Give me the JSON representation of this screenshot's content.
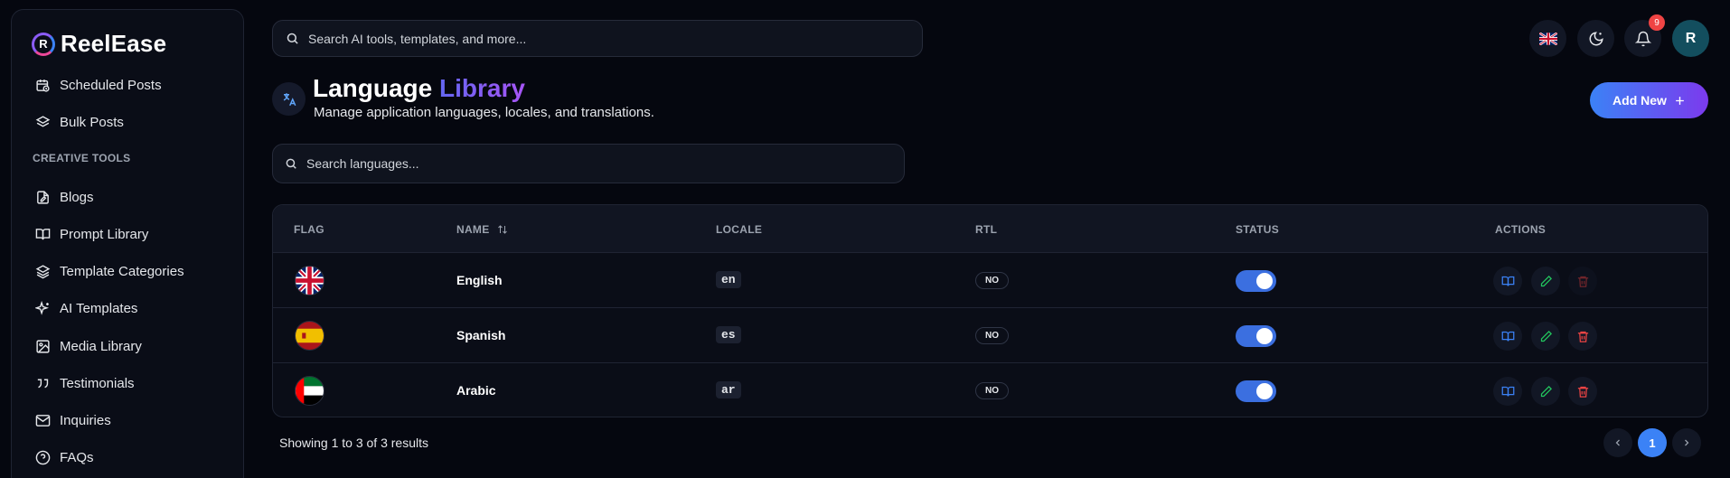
{
  "app": {
    "name": "ReelEase",
    "logo_letter": "R"
  },
  "sidebar": {
    "items_top": [
      {
        "label": "Scheduled Posts",
        "icon": "calendar-clock-icon"
      },
      {
        "label": "Bulk Posts",
        "icon": "layers-icon"
      }
    ],
    "section_label": "CREATIVE TOOLS",
    "items": [
      {
        "label": "Blogs",
        "icon": "file-edit-icon"
      },
      {
        "label": "Prompt Library",
        "icon": "book-open-icon"
      },
      {
        "label": "Template Categories",
        "icon": "layers-icon"
      },
      {
        "label": "AI Templates",
        "icon": "sparkles-icon"
      },
      {
        "label": "Media Library",
        "icon": "image-icon"
      },
      {
        "label": "Testimonials",
        "icon": "quote-icon"
      },
      {
        "label": "Inquiries",
        "icon": "mail-icon"
      },
      {
        "label": "FAQs",
        "icon": "help-circle-icon"
      }
    ]
  },
  "topbar": {
    "search_placeholder": "Search AI tools, templates, and more...",
    "notification_count": "9",
    "avatar_letter": "R"
  },
  "header": {
    "title_main": "Language",
    "title_accent": "Library",
    "subtitle": "Manage application languages, locales, and translations.",
    "add_button": "Add New"
  },
  "library_search": {
    "placeholder": "Search languages..."
  },
  "table": {
    "columns": {
      "flag": "FLAG",
      "name": "NAME",
      "locale": "LOCALE",
      "rtl": "RTL",
      "status": "STATUS",
      "actions": "ACTIONS"
    },
    "rows": [
      {
        "name": "English",
        "locale": "en",
        "rtl": "NO",
        "status": true,
        "flag": "uk-flag-icon"
      },
      {
        "name": "Spanish",
        "locale": "es",
        "rtl": "NO",
        "status": true,
        "flag": "spain-flag-icon"
      },
      {
        "name": "Arabic",
        "locale": "ar",
        "rtl": "NO",
        "status": true,
        "flag": "uae-flag-icon"
      }
    ]
  },
  "pagination": {
    "summary": "Showing 1 to 3 of 3 results",
    "current_page": "1"
  },
  "colors": {
    "accent": "#3b82f6",
    "accent_purple": "#7c3aed",
    "danger": "#ef4444",
    "success": "#22c55e",
    "background": "#05070f"
  }
}
